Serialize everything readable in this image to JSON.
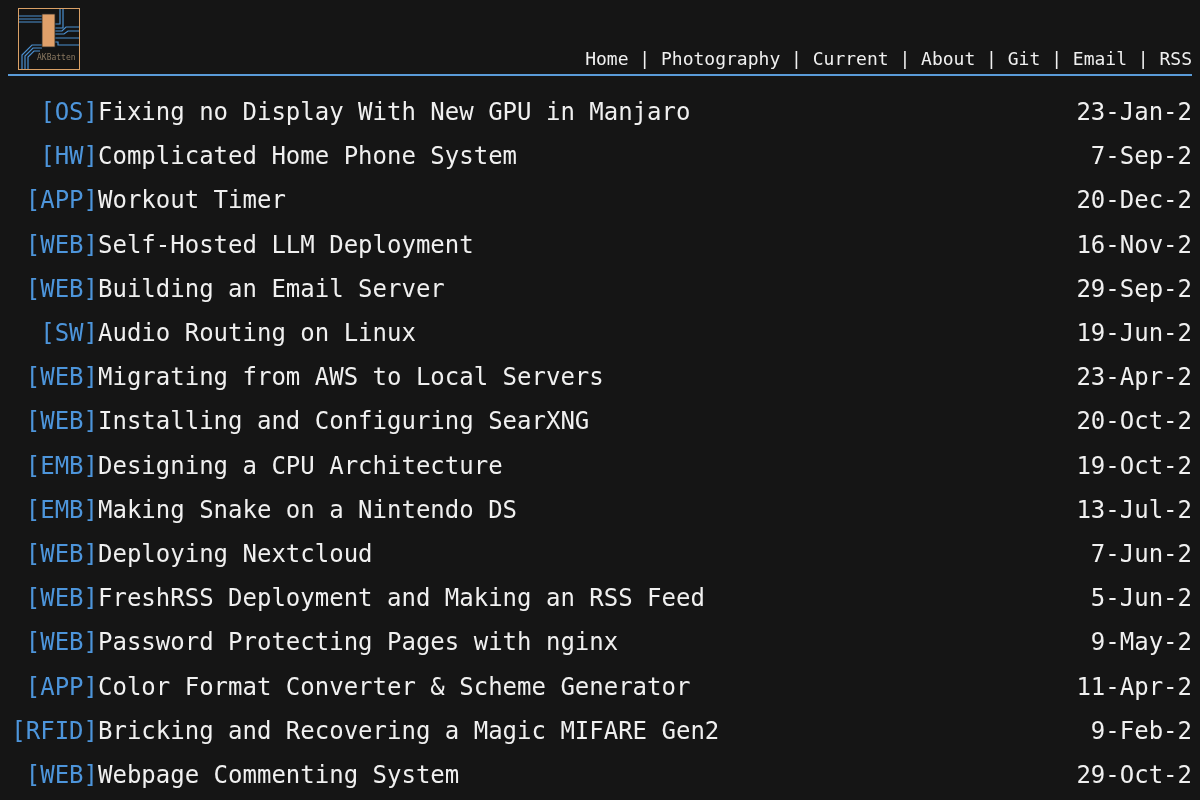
{
  "header": {
    "logo": {
      "text": "AKBatten"
    },
    "nav": {
      "links": [
        "Home",
        "Photography",
        "Current",
        "About",
        "Git",
        "Email",
        "RSS"
      ],
      "separator": "|"
    }
  },
  "posts": [
    {
      "tag": "[OS]",
      "title": "Fixing no Display With New GPU in Manjaro",
      "date": "23-Jan-2"
    },
    {
      "tag": "[HW]",
      "title": "Complicated Home Phone System",
      "date": "7-Sep-2"
    },
    {
      "tag": "[APP]",
      "title": "Workout Timer",
      "date": "20-Dec-2"
    },
    {
      "tag": "[WEB]",
      "title": "Self-Hosted LLM Deployment",
      "date": "16-Nov-2"
    },
    {
      "tag": "[WEB]",
      "title": "Building an Email Server",
      "date": "29-Sep-2"
    },
    {
      "tag": "[SW]",
      "title": "Audio Routing on Linux",
      "date": "19-Jun-2"
    },
    {
      "tag": "[WEB]",
      "title": "Migrating from AWS to Local Servers",
      "date": "23-Apr-2"
    },
    {
      "tag": "[WEB]",
      "title": "Installing and Configuring SearXNG",
      "date": "20-Oct-2"
    },
    {
      "tag": "[EMB]",
      "title": "Designing a CPU Architecture",
      "date": "19-Oct-2"
    },
    {
      "tag": "[EMB]",
      "title": "Making Snake on a Nintendo DS",
      "date": "13-Jul-2"
    },
    {
      "tag": "[WEB]",
      "title": "Deploying Nextcloud",
      "date": "7-Jun-2"
    },
    {
      "tag": "[WEB]",
      "title": "FreshRSS Deployment and Making an RSS Feed",
      "date": "5-Jun-2"
    },
    {
      "tag": "[WEB]",
      "title": "Password Protecting Pages with nginx",
      "date": "9-May-2"
    },
    {
      "tag": "[APP]",
      "title": "Color Format Converter & Scheme Generator",
      "date": "11-Apr-2"
    },
    {
      "tag": "[RFID]",
      "title": "Bricking and Recovering a Magic MIFARE Gen2",
      "date": "9-Feb-2"
    },
    {
      "tag": "[WEB]",
      "title": "Webpage Commenting System",
      "date": "29-Oct-2"
    }
  ]
}
